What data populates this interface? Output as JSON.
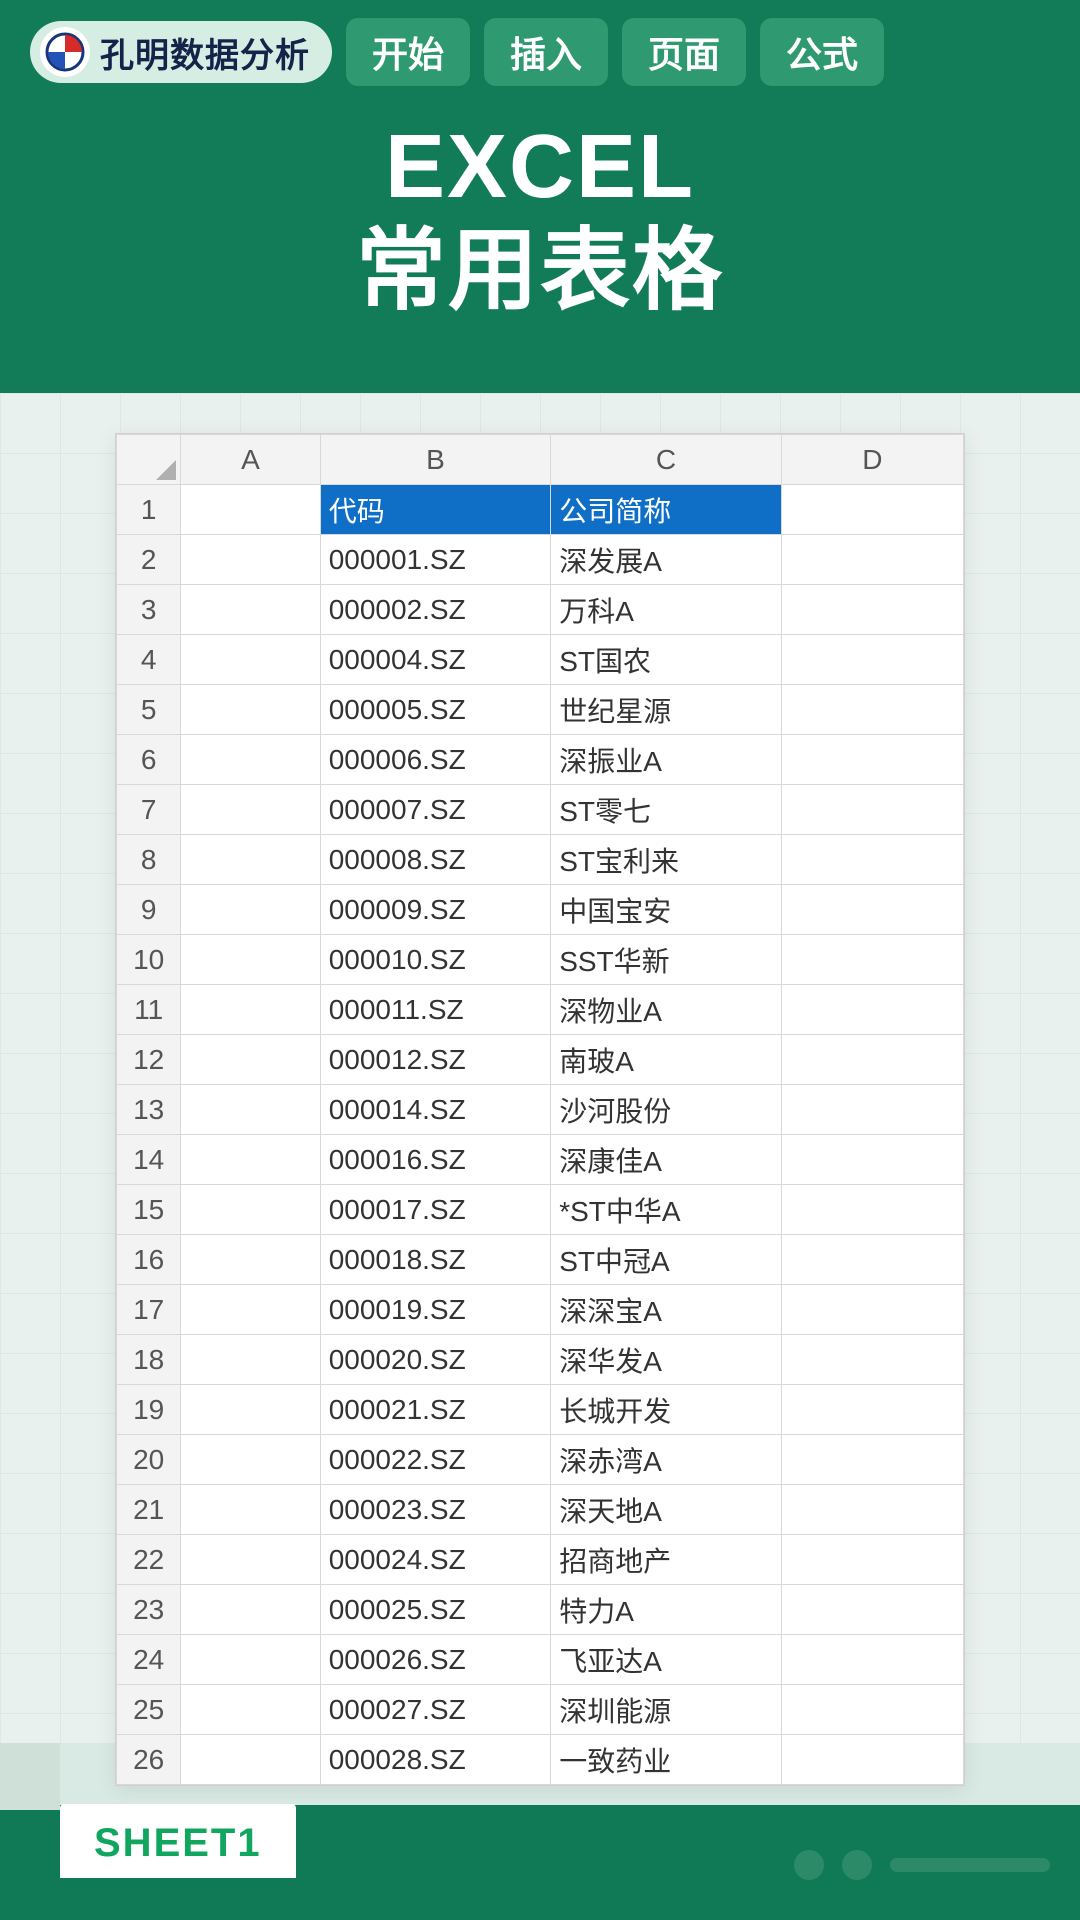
{
  "brand": {
    "name": "孔明数据分析"
  },
  "ribbon": {
    "tabs": [
      "开始",
      "插入",
      "页面",
      "公式"
    ]
  },
  "title": {
    "line1": "EXCEL",
    "line2": "常用表格"
  },
  "sheet": {
    "columns": [
      "A",
      "B",
      "C",
      "D"
    ],
    "header_row": {
      "b": "代码",
      "c": "公司简称"
    },
    "rows": [
      {
        "n": "1",
        "b": "代码",
        "c": "公司简称",
        "is_header": true
      },
      {
        "n": "2",
        "b": "000001.SZ",
        "c": "深发展A"
      },
      {
        "n": "3",
        "b": "000002.SZ",
        "c": "万科A"
      },
      {
        "n": "4",
        "b": "000004.SZ",
        "c": "ST国农"
      },
      {
        "n": "5",
        "b": "000005.SZ",
        "c": "世纪星源"
      },
      {
        "n": "6",
        "b": "000006.SZ",
        "c": "深振业A"
      },
      {
        "n": "7",
        "b": "000007.SZ",
        "c": "ST零七"
      },
      {
        "n": "8",
        "b": "000008.SZ",
        "c": "ST宝利来"
      },
      {
        "n": "9",
        "b": "000009.SZ",
        "c": "中国宝安"
      },
      {
        "n": "10",
        "b": "000010.SZ",
        "c": "SST华新"
      },
      {
        "n": "11",
        "b": "000011.SZ",
        "c": "深物业A"
      },
      {
        "n": "12",
        "b": "000012.SZ",
        "c": "南玻A"
      },
      {
        "n": "13",
        "b": "000014.SZ",
        "c": "沙河股份"
      },
      {
        "n": "14",
        "b": "000016.SZ",
        "c": "深康佳A"
      },
      {
        "n": "15",
        "b": "000017.SZ",
        "c": "*ST中华A"
      },
      {
        "n": "16",
        "b": "000018.SZ",
        "c": "ST中冠A"
      },
      {
        "n": "17",
        "b": "000019.SZ",
        "c": "深深宝A"
      },
      {
        "n": "18",
        "b": "000020.SZ",
        "c": "深华发A"
      },
      {
        "n": "19",
        "b": "000021.SZ",
        "c": "长城开发"
      },
      {
        "n": "20",
        "b": "000022.SZ",
        "c": "深赤湾A"
      },
      {
        "n": "21",
        "b": "000023.SZ",
        "c": "深天地A"
      },
      {
        "n": "22",
        "b": "000024.SZ",
        "c": "招商地产"
      },
      {
        "n": "23",
        "b": "000025.SZ",
        "c": "特力A"
      },
      {
        "n": "24",
        "b": "000026.SZ",
        "c": "飞亚达A"
      },
      {
        "n": "25",
        "b": "000027.SZ",
        "c": "深圳能源"
      },
      {
        "n": "26",
        "b": "000028.SZ",
        "c": "一致药业"
      }
    ]
  },
  "footer": {
    "active_tab": "SHEET1"
  }
}
